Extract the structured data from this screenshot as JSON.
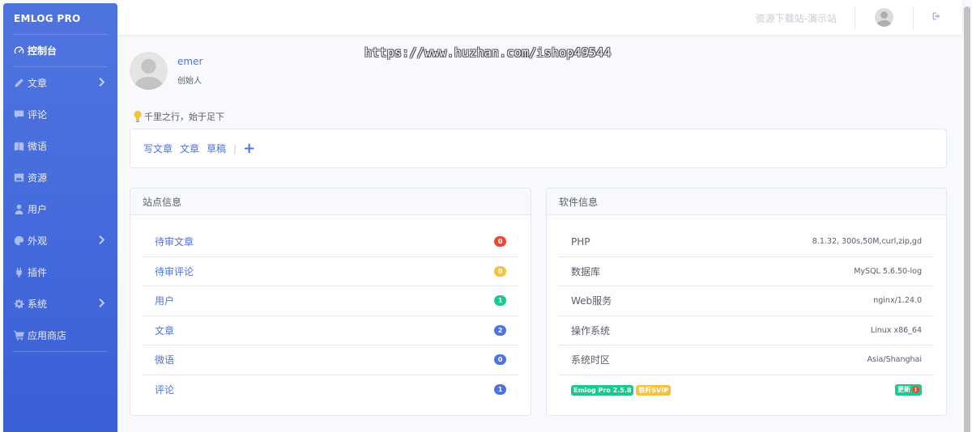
{
  "colors": {
    "primary": "#4e73df",
    "danger": "#e74a3b",
    "warning": "#f6c23e",
    "success": "#1cc88a",
    "info": "#4e73df"
  },
  "brand": "EMLOG PRO",
  "sidebar": {
    "items": [
      {
        "label": "控制台",
        "icon": "dashboard-icon"
      },
      {
        "label": "文章",
        "icon": "pencil-icon",
        "has_submenu": true
      },
      {
        "label": "评论",
        "icon": "comment-icon"
      },
      {
        "label": "微语",
        "icon": "note-icon"
      },
      {
        "label": "资源",
        "icon": "image-icon"
      },
      {
        "label": "用户",
        "icon": "user-icon"
      },
      {
        "label": "外观",
        "icon": "palette-icon",
        "has_submenu": true
      },
      {
        "label": "插件",
        "icon": "plug-icon"
      },
      {
        "label": "系统",
        "icon": "gear-icon",
        "has_submenu": true
      },
      {
        "label": "应用商店",
        "icon": "cart-icon"
      }
    ]
  },
  "topbar": {
    "site_link": "资源下载站-演示站"
  },
  "watermark": "https://www.huzhan.com/ishop49544",
  "profile": {
    "name": "emer",
    "role": "创始人"
  },
  "motto": "千里之行，始于足下",
  "quick_actions": {
    "write": "写文章",
    "articles": "文章",
    "drafts": "草稿",
    "add": "+"
  },
  "site_info": {
    "title": "站点信息",
    "rows": [
      {
        "label": "待审文章",
        "count": "0",
        "color": "#e74a3b"
      },
      {
        "label": "待审评论",
        "count": "0",
        "color": "#f6c23e"
      },
      {
        "label": "用户",
        "count": "1",
        "color": "#1cc88a"
      },
      {
        "label": "文章",
        "count": "2",
        "color": "#4e73df"
      },
      {
        "label": "微语",
        "count": "0",
        "color": "#4e73df"
      },
      {
        "label": "评论",
        "count": "1",
        "color": "#4e73df"
      }
    ]
  },
  "software_info": {
    "title": "软件信息",
    "rows": [
      {
        "label": "PHP",
        "value": "8.1.32, 300s,50M,curl,zip,gd"
      },
      {
        "label": "数据库",
        "value": "MySQL 5.6.50-log"
      },
      {
        "label": "Web服务",
        "value": "nginx/1.24.0"
      },
      {
        "label": "操作系统",
        "value": "Linux x86_64"
      },
      {
        "label": "系统时区",
        "value": "Asia/Shanghai"
      }
    ],
    "version_badge": "Emlog Pro 2.5.8",
    "vip_badge": "铁杆SVIP",
    "update_label": "更新",
    "update_alert": "!"
  }
}
